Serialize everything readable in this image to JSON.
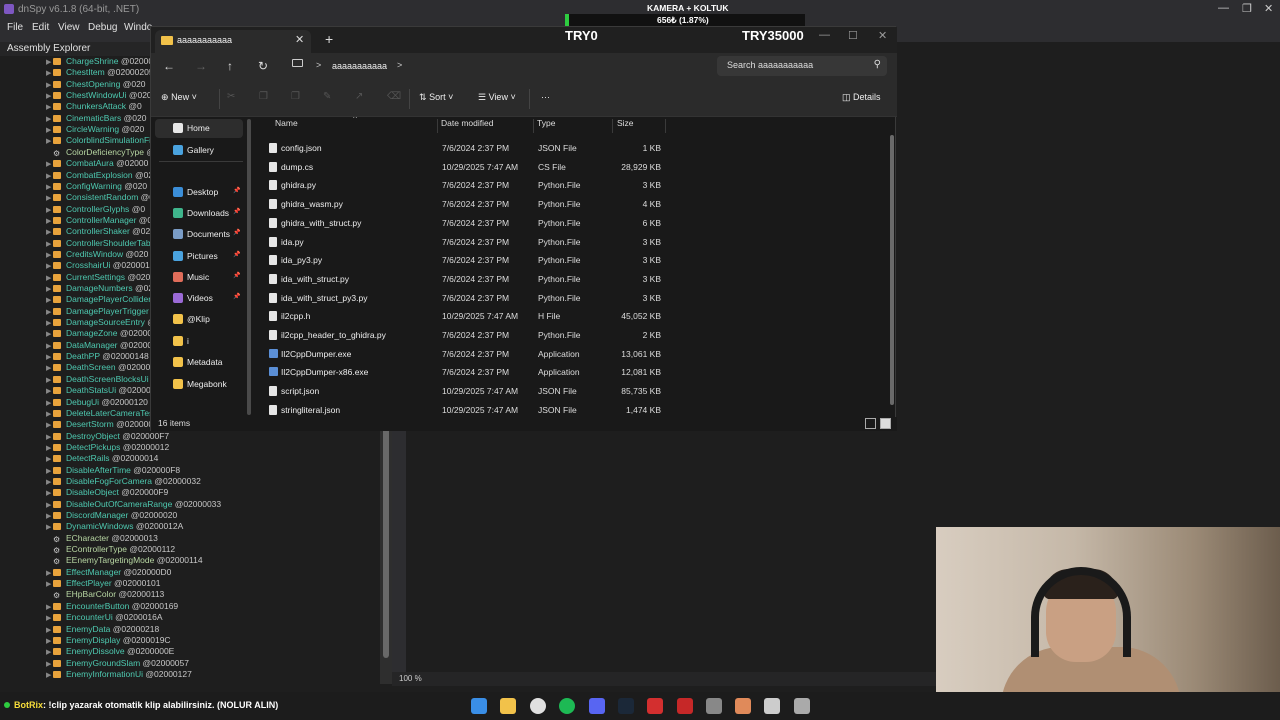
{
  "dnspy": {
    "title": "dnSpy v6.1.8 (64-bit, .NET)",
    "menu": [
      "File",
      "Edit",
      "View",
      "Debug",
      "Windo"
    ],
    "assembly_explorer_label": "Assembly Explorer",
    "tree_items": [
      {
        "name": "ChargeShrine",
        "token": "@02000205"
      },
      {
        "name": "ChestItem",
        "token": "@02000205"
      },
      {
        "name": "ChestOpening",
        "token": "@020"
      },
      {
        "name": "ChestWindowUi",
        "token": "@020"
      },
      {
        "name": "ChunkersAttack",
        "token": "@0"
      },
      {
        "name": "CinematicBars",
        "token": "@020"
      },
      {
        "name": "CircleWarning",
        "token": "@020"
      },
      {
        "name": "ColorblindSimulationFi",
        "token": ""
      },
      {
        "name": "ColorDeficiencyType",
        "token": "@"
      },
      {
        "name": "CombatAura",
        "token": "@02000"
      },
      {
        "name": "CombatExplosion",
        "token": "@02"
      },
      {
        "name": "ConfigWarning",
        "token": "@020"
      },
      {
        "name": "ConsistentRandom",
        "token": "@0"
      },
      {
        "name": "ControllerGlyphs",
        "token": "@0"
      },
      {
        "name": "ControllerManager",
        "token": "@0"
      },
      {
        "name": "ControllerShaker",
        "token": "@020"
      },
      {
        "name": "ControllerShoulderTab",
        "token": ""
      },
      {
        "name": "CreditsWindow",
        "token": "@020"
      },
      {
        "name": "CrosshairUi",
        "token": "@0200014"
      },
      {
        "name": "CurrentSettings",
        "token": "@020"
      },
      {
        "name": "DamageNumbers",
        "token": "@020"
      },
      {
        "name": "DamagePlayerCollider",
        "token": ""
      },
      {
        "name": "DamagePlayerTrigger",
        "token": "@"
      },
      {
        "name": "DamageSourceEntry",
        "token": "@0"
      },
      {
        "name": "DamageZone",
        "token": "@0200003"
      },
      {
        "name": "DataManager",
        "token": "@020000"
      },
      {
        "name": "DeathPP",
        "token": "@02000148"
      },
      {
        "name": "DeathScreen",
        "token": "@0200014"
      },
      {
        "name": "DeathScreenBlocksUi",
        "token": "@0"
      },
      {
        "name": "DeathStatsUi",
        "token": "@0200014"
      },
      {
        "name": "DebugUi",
        "token": "@02000120"
      },
      {
        "name": "DeleteLaterCameraTest",
        "token": ""
      },
      {
        "name": "DesertStorm",
        "token": "@0200007"
      },
      {
        "name": "DestroyObject",
        "token": "@020000F7"
      },
      {
        "name": "DetectPickups",
        "token": "@02000012"
      },
      {
        "name": "DetectRails",
        "token": "@02000014"
      },
      {
        "name": "DisableAfterTime",
        "token": "@020000F8"
      },
      {
        "name": "DisableFogForCamera",
        "token": "@02000032"
      },
      {
        "name": "DisableObject",
        "token": "@020000F9"
      },
      {
        "name": "DisableOutOfCameraRange",
        "token": "@02000033"
      },
      {
        "name": "DiscordManager",
        "token": "@02000020"
      },
      {
        "name": "DynamicWindows",
        "token": "@0200012A"
      },
      {
        "name": "ECharacter",
        "token": "@02000013"
      },
      {
        "name": "EControllerType",
        "token": "@02000112"
      },
      {
        "name": "EEnemyTargetingMode",
        "token": "@02000114"
      },
      {
        "name": "EffectManager",
        "token": "@020000D0"
      },
      {
        "name": "EffectPlayer",
        "token": "@02000101"
      },
      {
        "name": "EHpBarColor",
        "token": "@02000113"
      },
      {
        "name": "EncounterButton",
        "token": "@02000169"
      },
      {
        "name": "EncounterUi",
        "token": "@0200016A"
      },
      {
        "name": "EnemyData",
        "token": "@02000218"
      },
      {
        "name": "EnemyDisplay",
        "token": "@0200019C"
      },
      {
        "name": "EnemyDissolve",
        "token": "@0200000E"
      },
      {
        "name": "EnemyGroundSlam",
        "token": "@02000057"
      },
      {
        "name": "EnemyInformationUi",
        "token": "@02000127"
      }
    ],
    "zoom_label": "100 %"
  },
  "explorer": {
    "tab_title": "aaaaaaaaaaa",
    "new_tab": "+",
    "breadcrumb": "aaaaaaaaaaa",
    "search_placeholder": "Search aaaaaaaaaaa",
    "commands": {
      "new": "New",
      "sort": "Sort",
      "view": "View",
      "more": "···",
      "details": "Details"
    },
    "nav": [
      {
        "label": "Home",
        "selected": true,
        "pinned": false,
        "color": "#e8e8e8"
      },
      {
        "label": "Gallery",
        "selected": false,
        "pinned": false,
        "color": "#4aa3df"
      },
      {
        "label": "Desktop",
        "selected": false,
        "pinned": true,
        "color": "#3b8ed8"
      },
      {
        "label": "Downloads",
        "selected": false,
        "pinned": true,
        "color": "#3fb58c"
      },
      {
        "label": "Documents",
        "selected": false,
        "pinned": true,
        "color": "#7a9cc6"
      },
      {
        "label": "Pictures",
        "selected": false,
        "pinned": true,
        "color": "#4aa3df"
      },
      {
        "label": "Music",
        "selected": false,
        "pinned": true,
        "color": "#e06d5a"
      },
      {
        "label": "Videos",
        "selected": false,
        "pinned": true,
        "color": "#9b6ad6"
      },
      {
        "label": "@Klip",
        "selected": false,
        "pinned": false,
        "color": "#f2c24a"
      },
      {
        "label": "i",
        "selected": false,
        "pinned": false,
        "color": "#f2c24a"
      },
      {
        "label": "Metadata",
        "selected": false,
        "pinned": false,
        "color": "#f2c24a"
      },
      {
        "label": "Megabonk",
        "selected": false,
        "pinned": false,
        "color": "#f2c24a"
      }
    ],
    "columns": {
      "name": "Name",
      "date": "Date modified",
      "type": "Type",
      "size": "Size"
    },
    "files": [
      {
        "name": "config.json",
        "date": "7/6/2024 2:37 PM",
        "type": "JSON File",
        "size": "1 KB",
        "icon": "file"
      },
      {
        "name": "dump.cs",
        "date": "10/29/2025 7:47 AM",
        "type": "CS File",
        "size": "28,929 KB",
        "icon": "file"
      },
      {
        "name": "ghidra.py",
        "date": "7/6/2024 2:37 PM",
        "type": "Python.File",
        "size": "3 KB",
        "icon": "file"
      },
      {
        "name": "ghidra_wasm.py",
        "date": "7/6/2024 2:37 PM",
        "type": "Python.File",
        "size": "4 KB",
        "icon": "file"
      },
      {
        "name": "ghidra_with_struct.py",
        "date": "7/6/2024 2:37 PM",
        "type": "Python.File",
        "size": "6 KB",
        "icon": "file"
      },
      {
        "name": "ida.py",
        "date": "7/6/2024 2:37 PM",
        "type": "Python.File",
        "size": "3 KB",
        "icon": "file"
      },
      {
        "name": "ida_py3.py",
        "date": "7/6/2024 2:37 PM",
        "type": "Python.File",
        "size": "3 KB",
        "icon": "file"
      },
      {
        "name": "ida_with_struct.py",
        "date": "7/6/2024 2:37 PM",
        "type": "Python.File",
        "size": "3 KB",
        "icon": "file"
      },
      {
        "name": "ida_with_struct_py3.py",
        "date": "7/6/2024 2:37 PM",
        "type": "Python.File",
        "size": "3 KB",
        "icon": "file"
      },
      {
        "name": "il2cpp.h",
        "date": "10/29/2025 7:47 AM",
        "type": "H File",
        "size": "45,052 KB",
        "icon": "file"
      },
      {
        "name": "il2cpp_header_to_ghidra.py",
        "date": "7/6/2024 2:37 PM",
        "type": "Python.File",
        "size": "2 KB",
        "icon": "file"
      },
      {
        "name": "Il2CppDumper.exe",
        "date": "7/6/2024 2:37 PM",
        "type": "Application",
        "size": "13,061 KB",
        "icon": "app"
      },
      {
        "name": "Il2CppDumper-x86.exe",
        "date": "7/6/2024 2:37 PM",
        "type": "Application",
        "size": "12,081 KB",
        "icon": "app"
      },
      {
        "name": "script.json",
        "date": "10/29/2025 7:47 AM",
        "type": "JSON File",
        "size": "85,735 KB",
        "icon": "file"
      },
      {
        "name": "stringliteral.json",
        "date": "10/29/2025 7:47 AM",
        "type": "JSON File",
        "size": "1,474 KB",
        "icon": "file"
      }
    ],
    "status_count": "16 items"
  },
  "overlay": {
    "camera_label": "KAMERA + KOLTUK",
    "camera_value": "656₺ (1.87%)",
    "camera_progress_percent": 1.87,
    "try_left": "TRY0",
    "try_right": "TRY35000"
  },
  "taskbar": {
    "chat_user": "BotRix",
    "chat_message": ": !clip yazarak otomatik klip alabilirsiniz. (NOLUR ALIN)",
    "icons": [
      "windows-start-icon",
      "file-explorer-icon",
      "chrome-icon",
      "spotify-icon",
      "discord-icon",
      "steam-icon",
      "app-red-icon",
      "app-stripes-icon",
      "obs-icon",
      "app-figure-icon",
      "7zip-icon",
      "task-view-icon"
    ]
  }
}
